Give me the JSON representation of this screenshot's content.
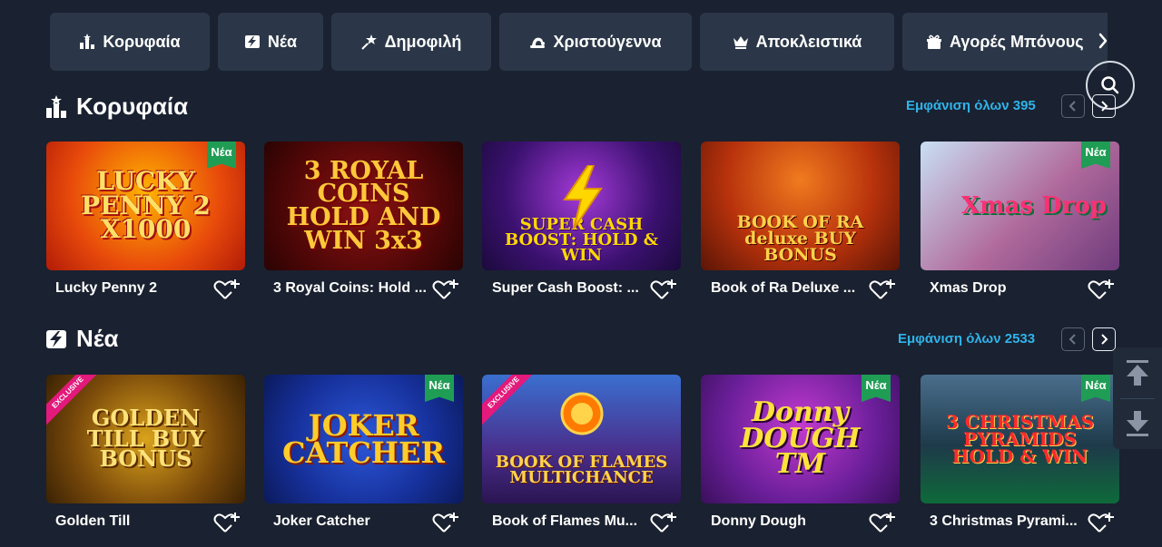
{
  "categories": [
    {
      "label": "Κορυφαία",
      "icon": "trophy-icon"
    },
    {
      "label": "Νέα",
      "icon": "new-flash-icon"
    },
    {
      "label": "Δημοφιλή",
      "icon": "popular-star-icon"
    },
    {
      "label": "Χριστούγεννα",
      "icon": "santa-hat-icon"
    },
    {
      "label": "Αποκλειστικά",
      "icon": "crown-icon"
    },
    {
      "label": "Αγορές Μπόνους",
      "icon": "bonus-buy-icon"
    }
  ],
  "sections": [
    {
      "title": "Κορυφαία",
      "icon": "trophy-icon",
      "see_all": "Εμφάνιση όλων 395",
      "games": [
        {
          "name": "Lucky Penny 2",
          "art": "LUCKY PENNY 2 X1000",
          "badge": "Νέα"
        },
        {
          "name": "3 Royal Coins: Hold ...",
          "art": "3 ROYAL COINS HOLD AND WIN 3x3",
          "badge": ""
        },
        {
          "name": "Super Cash Boost: ...",
          "art": "SUPER CASH BOOST: HOLD & WIN",
          "badge": ""
        },
        {
          "name": "Book of Ra Deluxe ...",
          "art": "BOOK OF RA deluxe BUY BONUS",
          "badge": ""
        },
        {
          "name": "Xmas Drop",
          "art": "Xmas Drop",
          "badge": "Νέα"
        }
      ]
    },
    {
      "title": "Νέα",
      "icon": "new-flash-icon",
      "see_all": "Εμφάνιση όλων 2533",
      "games": [
        {
          "name": "Golden Till",
          "art": "GOLDEN TILL BUY BONUS",
          "badge": "EXCLUSIVE"
        },
        {
          "name": "Joker Catcher",
          "art": "JOKER CATCHER",
          "badge": "Νέα"
        },
        {
          "name": "Book of Flames Mu...",
          "art": "BOOK OF FLAMES MULTICHANCE",
          "badge": "EXCLUSIVE"
        },
        {
          "name": "Donny Dough",
          "art": "Donny DOUGH TM",
          "badge": "Νέα"
        },
        {
          "name": "3 Christmas Pyrami...",
          "art": "3 CHRISTMAS PYRAMIDS HOLD & WIN",
          "badge": "Νέα"
        }
      ]
    }
  ],
  "colors": {
    "background": "#1a2130",
    "tile": "#2b3748",
    "accent_link": "#2fb4ea",
    "new_badge": "#1f9d55",
    "exclusive_badge": "#e3197b"
  }
}
